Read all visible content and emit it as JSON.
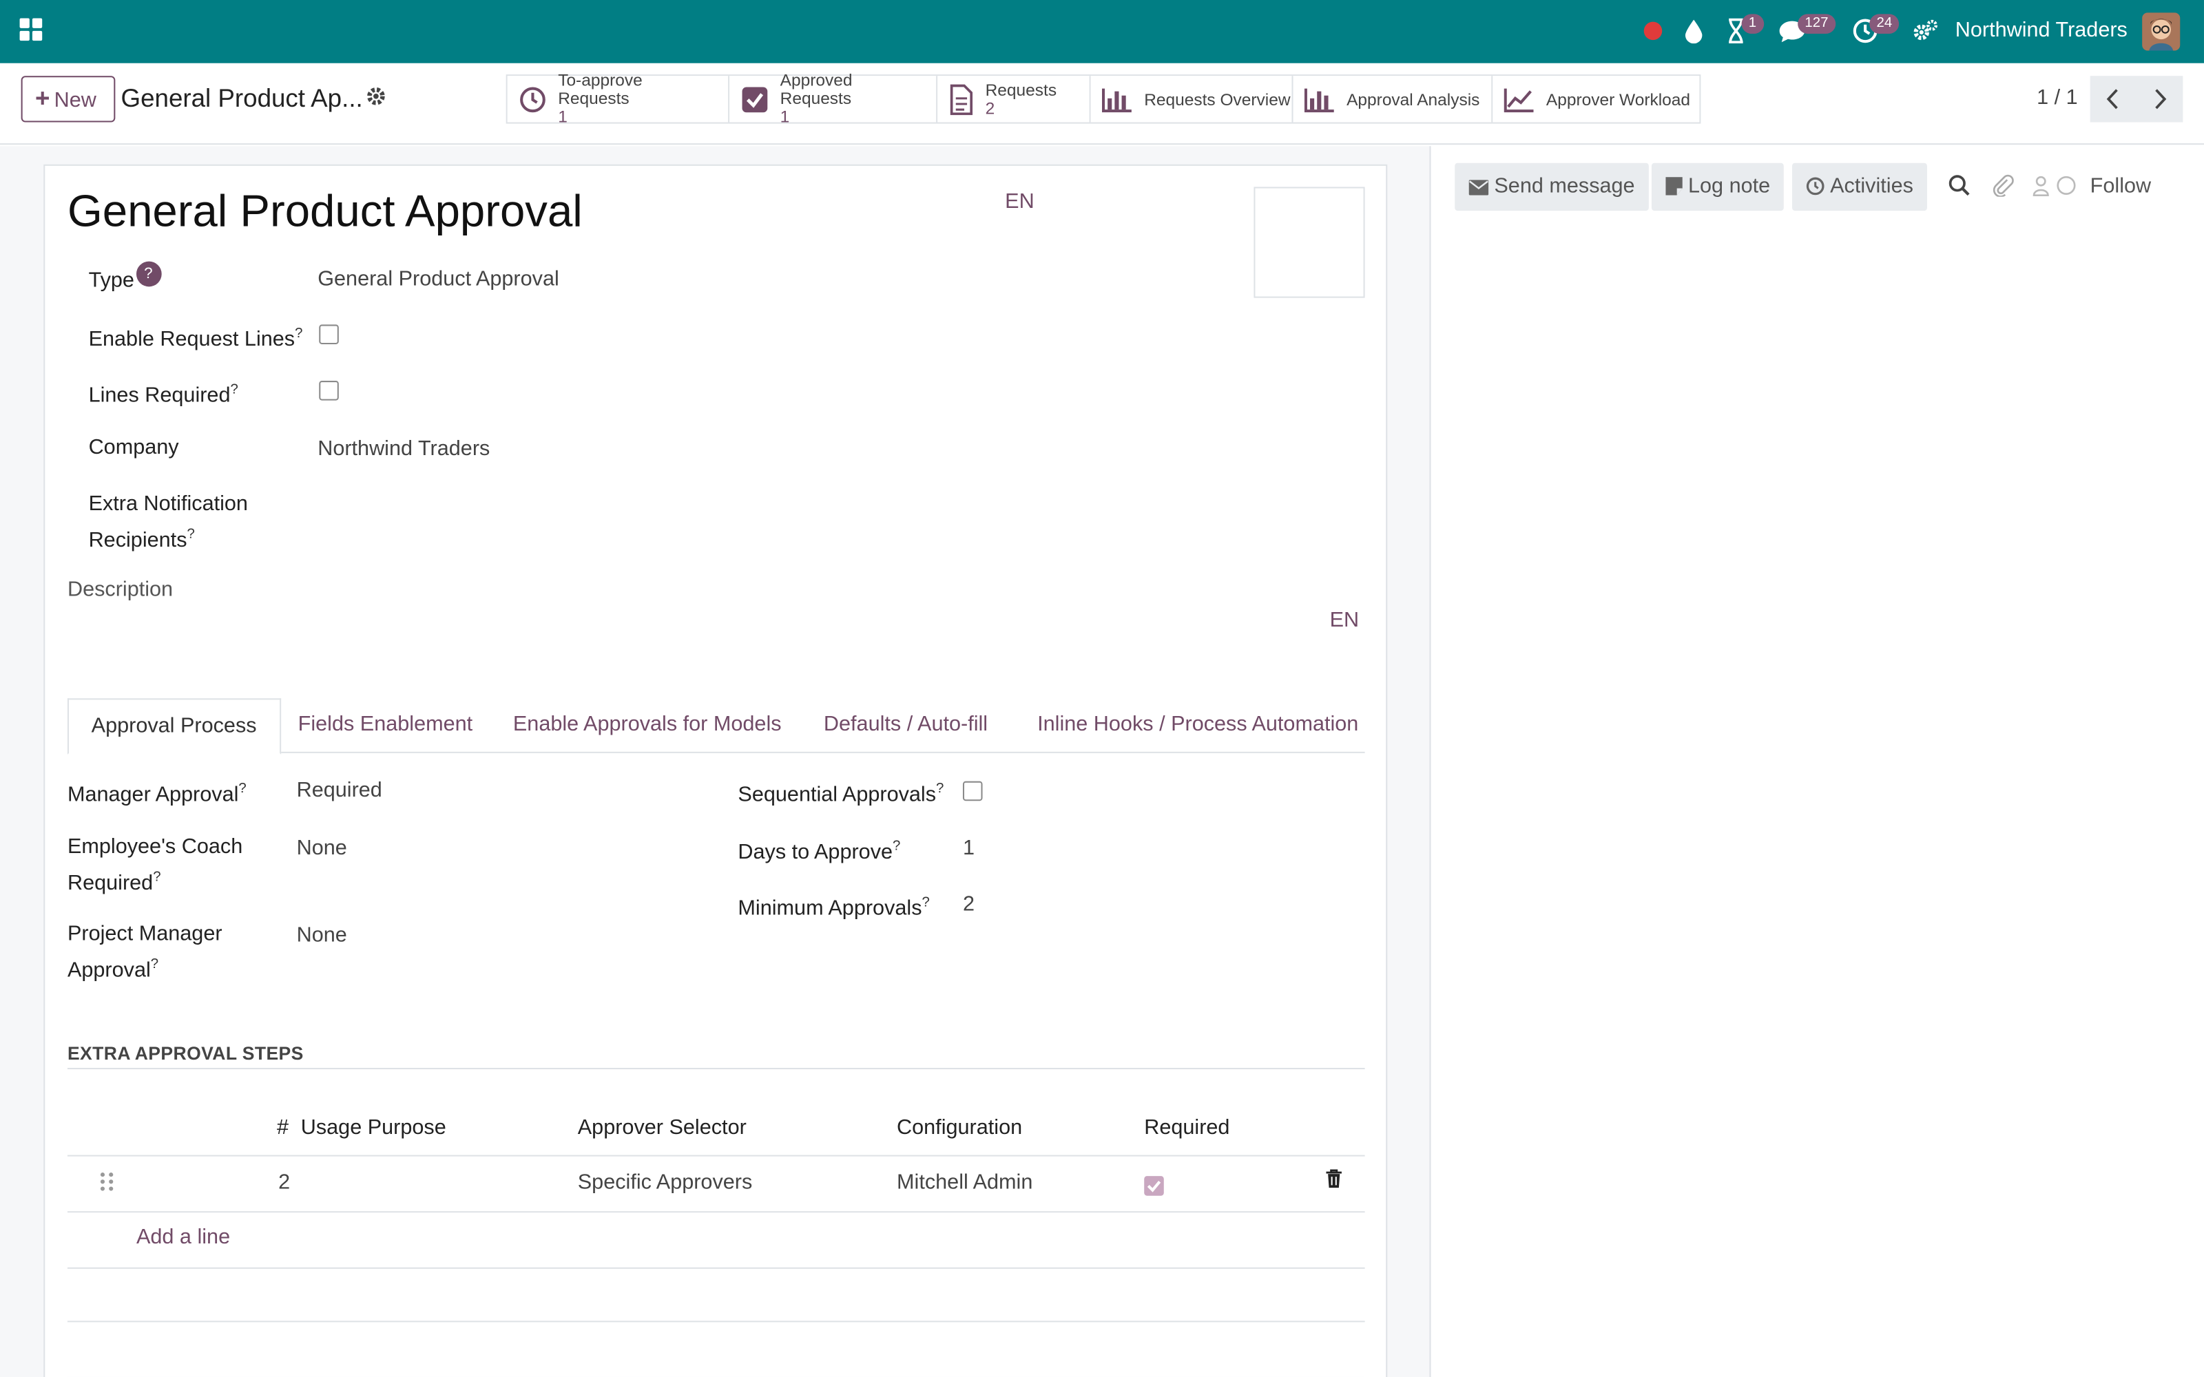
{
  "navbar": {
    "company": "Northwind Traders",
    "activity_badge": "1",
    "messages_badge": "127",
    "clock_badge": "24"
  },
  "control": {
    "new_label": "New",
    "breadcrumb": "General Product Ap...",
    "smart_buttons": [
      {
        "label": "To-approve Requests",
        "value": "1"
      },
      {
        "label": "Approved Requests",
        "value": "1"
      },
      {
        "label": "Requests",
        "value": "2"
      },
      {
        "label": "Requests Overview"
      },
      {
        "label": "Approval Analysis"
      },
      {
        "label": "Approver Workload"
      }
    ],
    "pager": "1 / 1"
  },
  "form": {
    "title": "General Product Approval",
    "lang": "EN",
    "fields": {
      "type_label": "Type",
      "type_value": "General Product Approval",
      "enable_lines_label": "Enable Request Lines",
      "lines_required_label": "Lines Required",
      "company_label": "Company",
      "company_value": "Northwind Traders",
      "extra_notif_label_1": "Extra Notification",
      "extra_notif_label_2": "Recipients",
      "description_label": "Description"
    },
    "tabs": [
      "Approval Process",
      "Fields Enablement",
      "Enable Approvals for Models",
      "Defaults / Auto-fill",
      "Inline Hooks / Process Automation"
    ],
    "approval": {
      "manager_label": "Manager Approval",
      "manager_value": "Required",
      "coach_label_1": "Employee's Coach",
      "coach_label_2": "Required",
      "coach_value": "None",
      "pm_label_1": "Project Manager",
      "pm_label_2": "Approval",
      "pm_value": "None",
      "sequential_label": "Sequential Approvals",
      "days_label": "Days to Approve",
      "days_value": "1",
      "min_label": "Minimum Approvals",
      "min_value": "2"
    },
    "steps": {
      "section_title": "EXTRA APPROVAL STEPS",
      "columns": [
        "#",
        "Usage Purpose",
        "Approver Selector",
        "Configuration",
        "Required"
      ],
      "rows": [
        {
          "num": "2",
          "purpose": "",
          "selector": "Specific Approvers",
          "configuration": "Mitchell Admin",
          "required": true
        }
      ],
      "add_line": "Add a line"
    }
  },
  "chatter": {
    "send_message": "Send message",
    "log_note": "Log note",
    "activities": "Activities",
    "follow": "Follow"
  },
  "colors": {
    "navbar": "#017e84",
    "accent": "#714b67",
    "badge": "#875a7b"
  }
}
